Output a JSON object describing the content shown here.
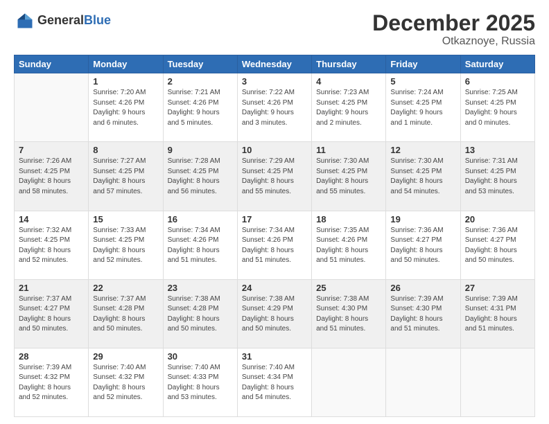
{
  "logo": {
    "line1": "General",
    "line2": "Blue"
  },
  "title": "December 2025",
  "location": "Otkaznoye, Russia",
  "days_of_week": [
    "Sunday",
    "Monday",
    "Tuesday",
    "Wednesday",
    "Thursday",
    "Friday",
    "Saturday"
  ],
  "weeks": [
    [
      {
        "day": "",
        "info": ""
      },
      {
        "day": "1",
        "info": "Sunrise: 7:20 AM\nSunset: 4:26 PM\nDaylight: 9 hours\nand 6 minutes."
      },
      {
        "day": "2",
        "info": "Sunrise: 7:21 AM\nSunset: 4:26 PM\nDaylight: 9 hours\nand 5 minutes."
      },
      {
        "day": "3",
        "info": "Sunrise: 7:22 AM\nSunset: 4:26 PM\nDaylight: 9 hours\nand 3 minutes."
      },
      {
        "day": "4",
        "info": "Sunrise: 7:23 AM\nSunset: 4:25 PM\nDaylight: 9 hours\nand 2 minutes."
      },
      {
        "day": "5",
        "info": "Sunrise: 7:24 AM\nSunset: 4:25 PM\nDaylight: 9 hours\nand 1 minute."
      },
      {
        "day": "6",
        "info": "Sunrise: 7:25 AM\nSunset: 4:25 PM\nDaylight: 9 hours\nand 0 minutes."
      }
    ],
    [
      {
        "day": "7",
        "info": "Sunrise: 7:26 AM\nSunset: 4:25 PM\nDaylight: 8 hours\nand 58 minutes."
      },
      {
        "day": "8",
        "info": "Sunrise: 7:27 AM\nSunset: 4:25 PM\nDaylight: 8 hours\nand 57 minutes."
      },
      {
        "day": "9",
        "info": "Sunrise: 7:28 AM\nSunset: 4:25 PM\nDaylight: 8 hours\nand 56 minutes."
      },
      {
        "day": "10",
        "info": "Sunrise: 7:29 AM\nSunset: 4:25 PM\nDaylight: 8 hours\nand 55 minutes."
      },
      {
        "day": "11",
        "info": "Sunrise: 7:30 AM\nSunset: 4:25 PM\nDaylight: 8 hours\nand 55 minutes."
      },
      {
        "day": "12",
        "info": "Sunrise: 7:30 AM\nSunset: 4:25 PM\nDaylight: 8 hours\nand 54 minutes."
      },
      {
        "day": "13",
        "info": "Sunrise: 7:31 AM\nSunset: 4:25 PM\nDaylight: 8 hours\nand 53 minutes."
      }
    ],
    [
      {
        "day": "14",
        "info": "Sunrise: 7:32 AM\nSunset: 4:25 PM\nDaylight: 8 hours\nand 52 minutes."
      },
      {
        "day": "15",
        "info": "Sunrise: 7:33 AM\nSunset: 4:25 PM\nDaylight: 8 hours\nand 52 minutes."
      },
      {
        "day": "16",
        "info": "Sunrise: 7:34 AM\nSunset: 4:26 PM\nDaylight: 8 hours\nand 51 minutes."
      },
      {
        "day": "17",
        "info": "Sunrise: 7:34 AM\nSunset: 4:26 PM\nDaylight: 8 hours\nand 51 minutes."
      },
      {
        "day": "18",
        "info": "Sunrise: 7:35 AM\nSunset: 4:26 PM\nDaylight: 8 hours\nand 51 minutes."
      },
      {
        "day": "19",
        "info": "Sunrise: 7:36 AM\nSunset: 4:27 PM\nDaylight: 8 hours\nand 50 minutes."
      },
      {
        "day": "20",
        "info": "Sunrise: 7:36 AM\nSunset: 4:27 PM\nDaylight: 8 hours\nand 50 minutes."
      }
    ],
    [
      {
        "day": "21",
        "info": "Sunrise: 7:37 AM\nSunset: 4:27 PM\nDaylight: 8 hours\nand 50 minutes."
      },
      {
        "day": "22",
        "info": "Sunrise: 7:37 AM\nSunset: 4:28 PM\nDaylight: 8 hours\nand 50 minutes."
      },
      {
        "day": "23",
        "info": "Sunrise: 7:38 AM\nSunset: 4:28 PM\nDaylight: 8 hours\nand 50 minutes."
      },
      {
        "day": "24",
        "info": "Sunrise: 7:38 AM\nSunset: 4:29 PM\nDaylight: 8 hours\nand 50 minutes."
      },
      {
        "day": "25",
        "info": "Sunrise: 7:38 AM\nSunset: 4:30 PM\nDaylight: 8 hours\nand 51 minutes."
      },
      {
        "day": "26",
        "info": "Sunrise: 7:39 AM\nSunset: 4:30 PM\nDaylight: 8 hours\nand 51 minutes."
      },
      {
        "day": "27",
        "info": "Sunrise: 7:39 AM\nSunset: 4:31 PM\nDaylight: 8 hours\nand 51 minutes."
      }
    ],
    [
      {
        "day": "28",
        "info": "Sunrise: 7:39 AM\nSunset: 4:32 PM\nDaylight: 8 hours\nand 52 minutes."
      },
      {
        "day": "29",
        "info": "Sunrise: 7:40 AM\nSunset: 4:32 PM\nDaylight: 8 hours\nand 52 minutes."
      },
      {
        "day": "30",
        "info": "Sunrise: 7:40 AM\nSunset: 4:33 PM\nDaylight: 8 hours\nand 53 minutes."
      },
      {
        "day": "31",
        "info": "Sunrise: 7:40 AM\nSunset: 4:34 PM\nDaylight: 8 hours\nand 54 minutes."
      },
      {
        "day": "",
        "info": ""
      },
      {
        "day": "",
        "info": ""
      },
      {
        "day": "",
        "info": ""
      }
    ]
  ]
}
